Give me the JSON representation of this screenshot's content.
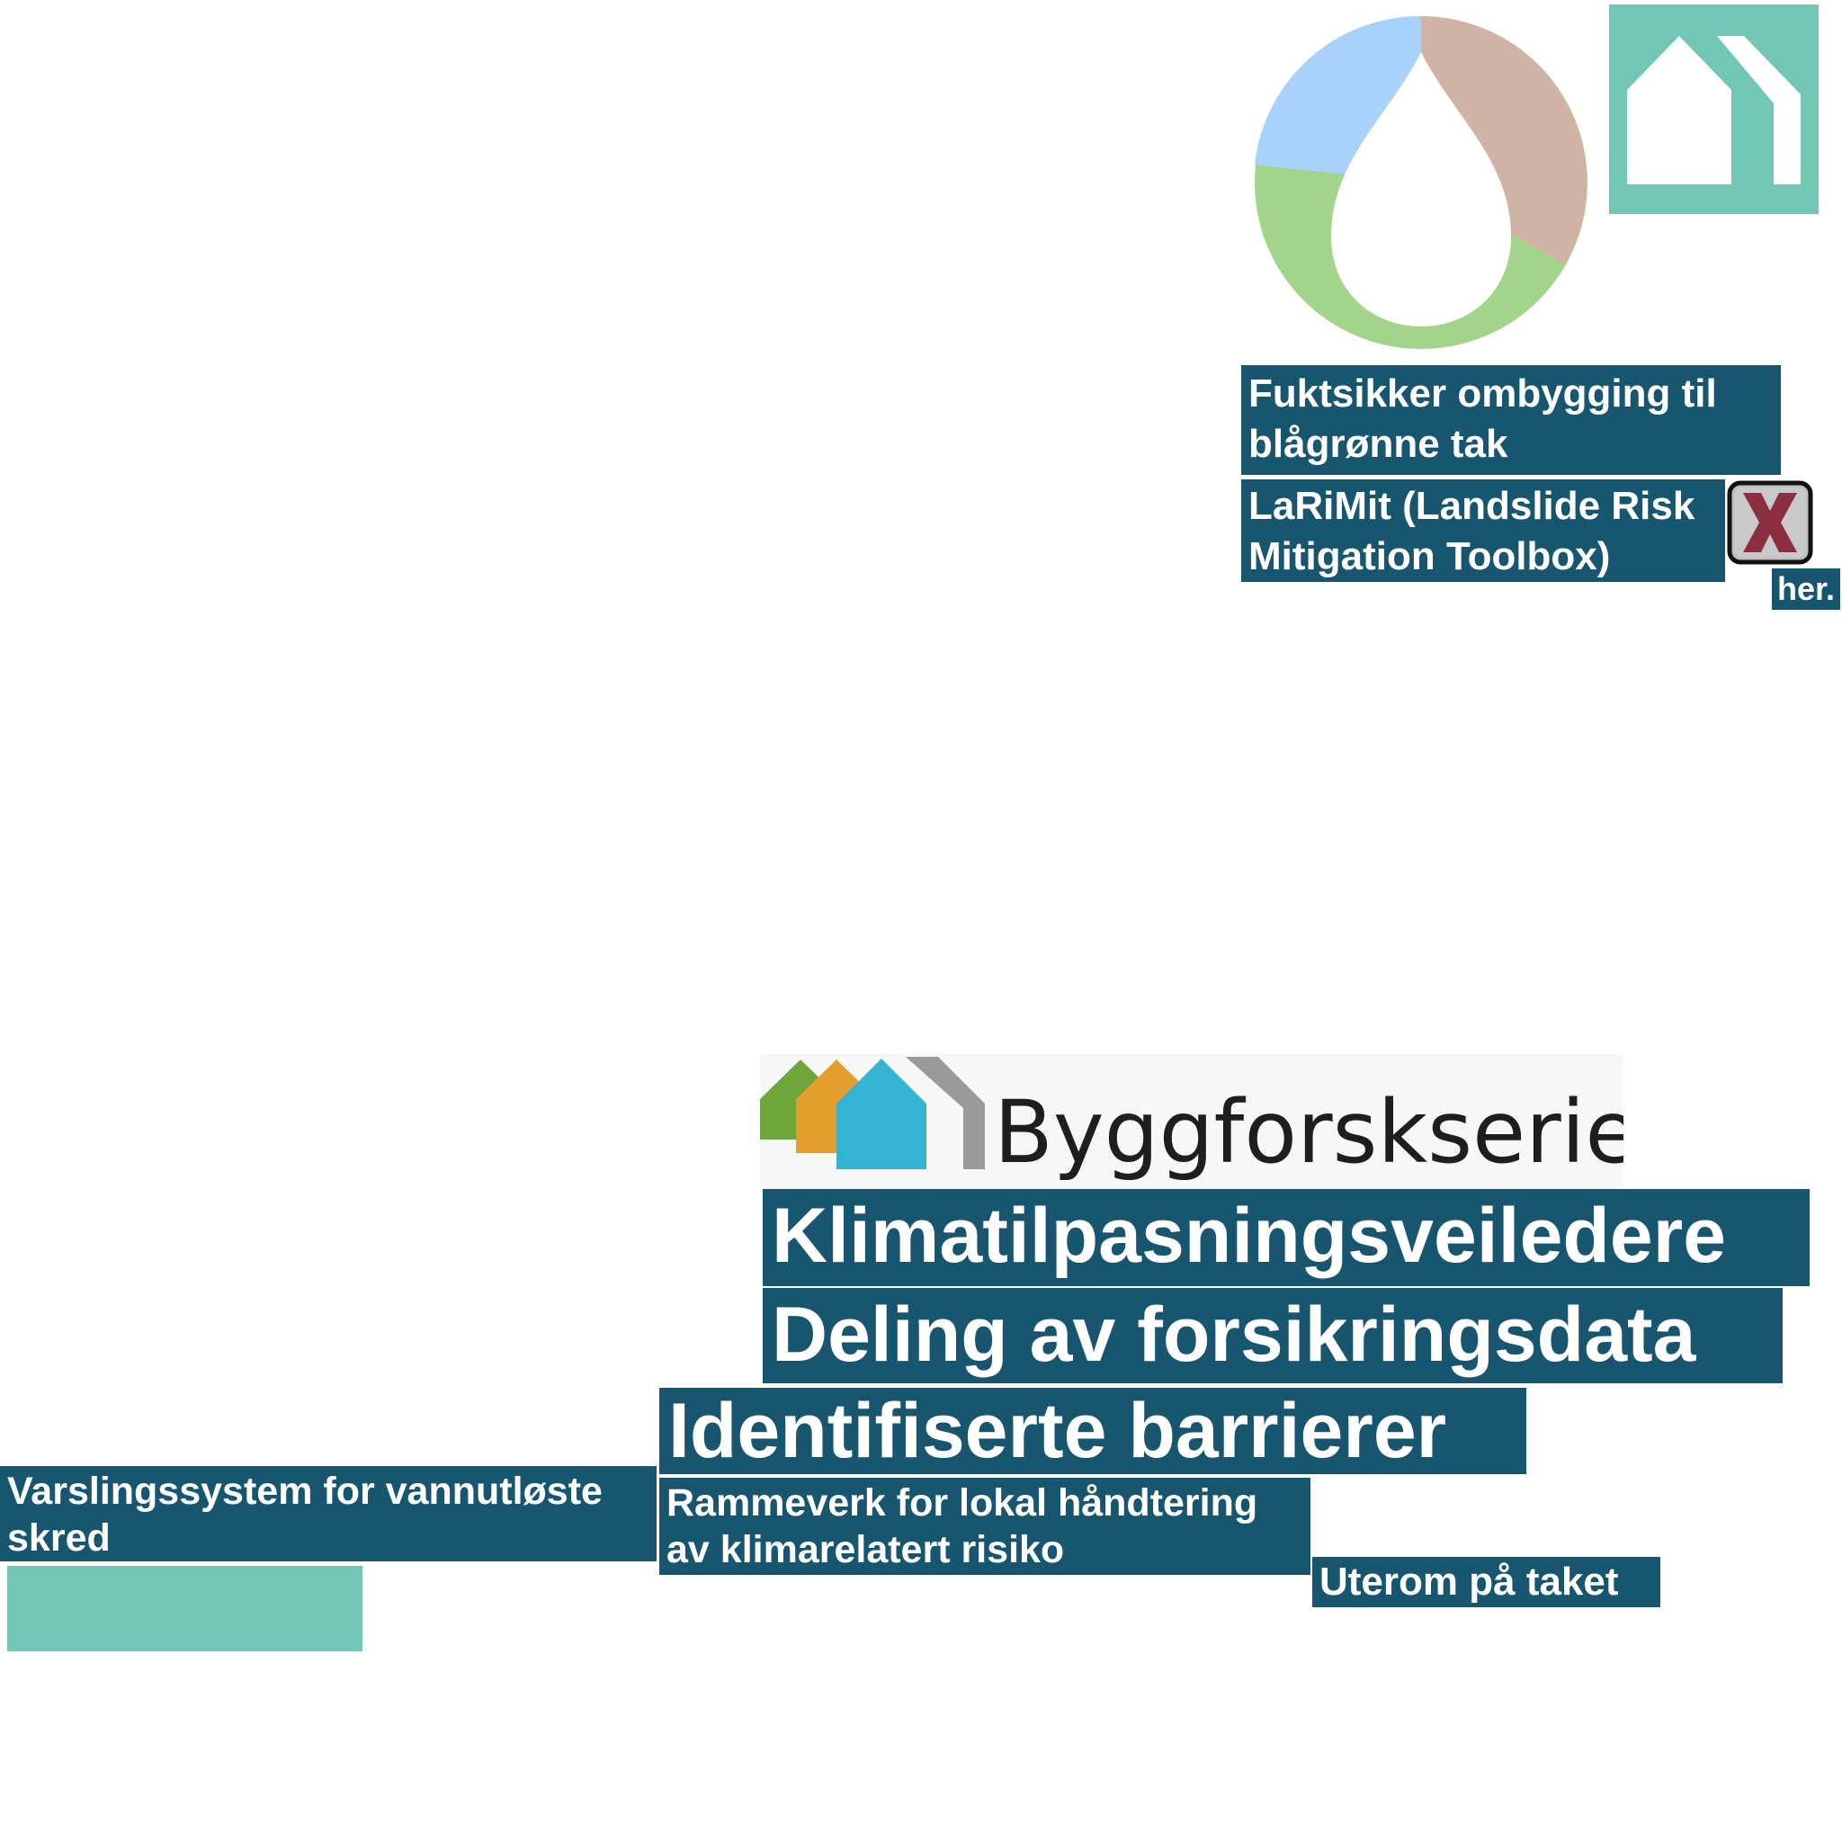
{
  "colors": {
    "tile_background": "#17566e",
    "tile_text": "#ffffff",
    "teal_accent": "#72c6b4",
    "ring_blue": "#a8d2fb",
    "ring_tan": "#cfb3a4",
    "ring_green": "#a2d58a",
    "logo_green": "#6ea63a",
    "logo_orange": "#e39e2c",
    "logo_blue": "#35b3d3",
    "logo_grey": "#9a9a9a",
    "logo_text": "#1e1e1e",
    "broken_image_x": "#8b2e40"
  },
  "icons": {
    "droplet_logo": "water-drop-ring-icon",
    "house_logo": "house-outline-icon",
    "broken_image": "broken-image-x-icon",
    "byggforsk_houses": "colored-houses-logo-icon"
  },
  "logos": {
    "byggforsk_wordmark": "Byggforskserien"
  },
  "tiles": {
    "fuktsikker": [
      "Fuktsikker ombygging til",
      "blågrønne tak"
    ],
    "larimit": [
      "LaRiMit (Landslide Risk",
      "Mitigation Toolbox)"
    ],
    "her": "her.",
    "klimatilpasning": "Klimatilpasningsveiledere",
    "deling": "Deling av forsikringsdata",
    "identifiserte": "Identifiserte barrierer",
    "varsling": [
      "Varslingssystem for vannutløste",
      "skred"
    ],
    "rammeverk": [
      "Rammeverk for lokal håndtering",
      "av klimarelatert risiko"
    ],
    "uterom": "Uterom på taket"
  }
}
